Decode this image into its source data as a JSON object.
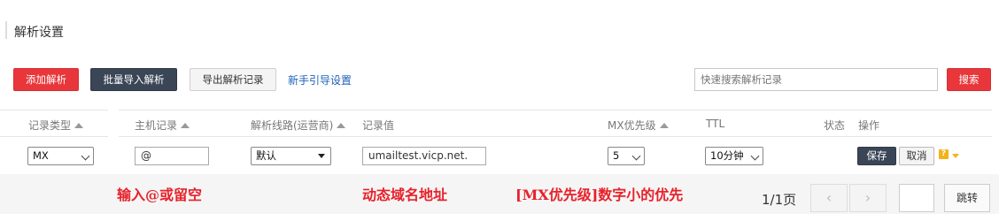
{
  "header": {
    "title": "解析设置"
  },
  "toolbar": {
    "add_label": "添加解析",
    "bulk_import_label": "批量导入解析",
    "export_label": "导出解析记录",
    "guide_link": "新手引导设置",
    "search_placeholder": "快速搜索解析记录",
    "search_button": "搜索"
  },
  "table": {
    "headers": {
      "record_type": "记录类型",
      "host": "主机记录",
      "line": "解析线路(运营商)",
      "value": "记录值",
      "mx_priority": "MX优先级",
      "ttl": "TTL",
      "status": "状态",
      "actions": "操作"
    },
    "edit_row": {
      "record_type": "MX",
      "host": "@",
      "line": "默认",
      "value": "umailtest.vicp.net.",
      "mx_priority": "5",
      "ttl": "10分钟",
      "save": "保存",
      "cancel": "取消",
      "help": "?"
    }
  },
  "annotations": {
    "host_hint": "输入@或留空",
    "value_hint": "动态域名地址",
    "mx_hint": "[MX优先级]数字小的优先"
  },
  "pagination": {
    "page_info": "1/1页",
    "prev": "‹",
    "next": "›",
    "jump_label": "跳转"
  }
}
